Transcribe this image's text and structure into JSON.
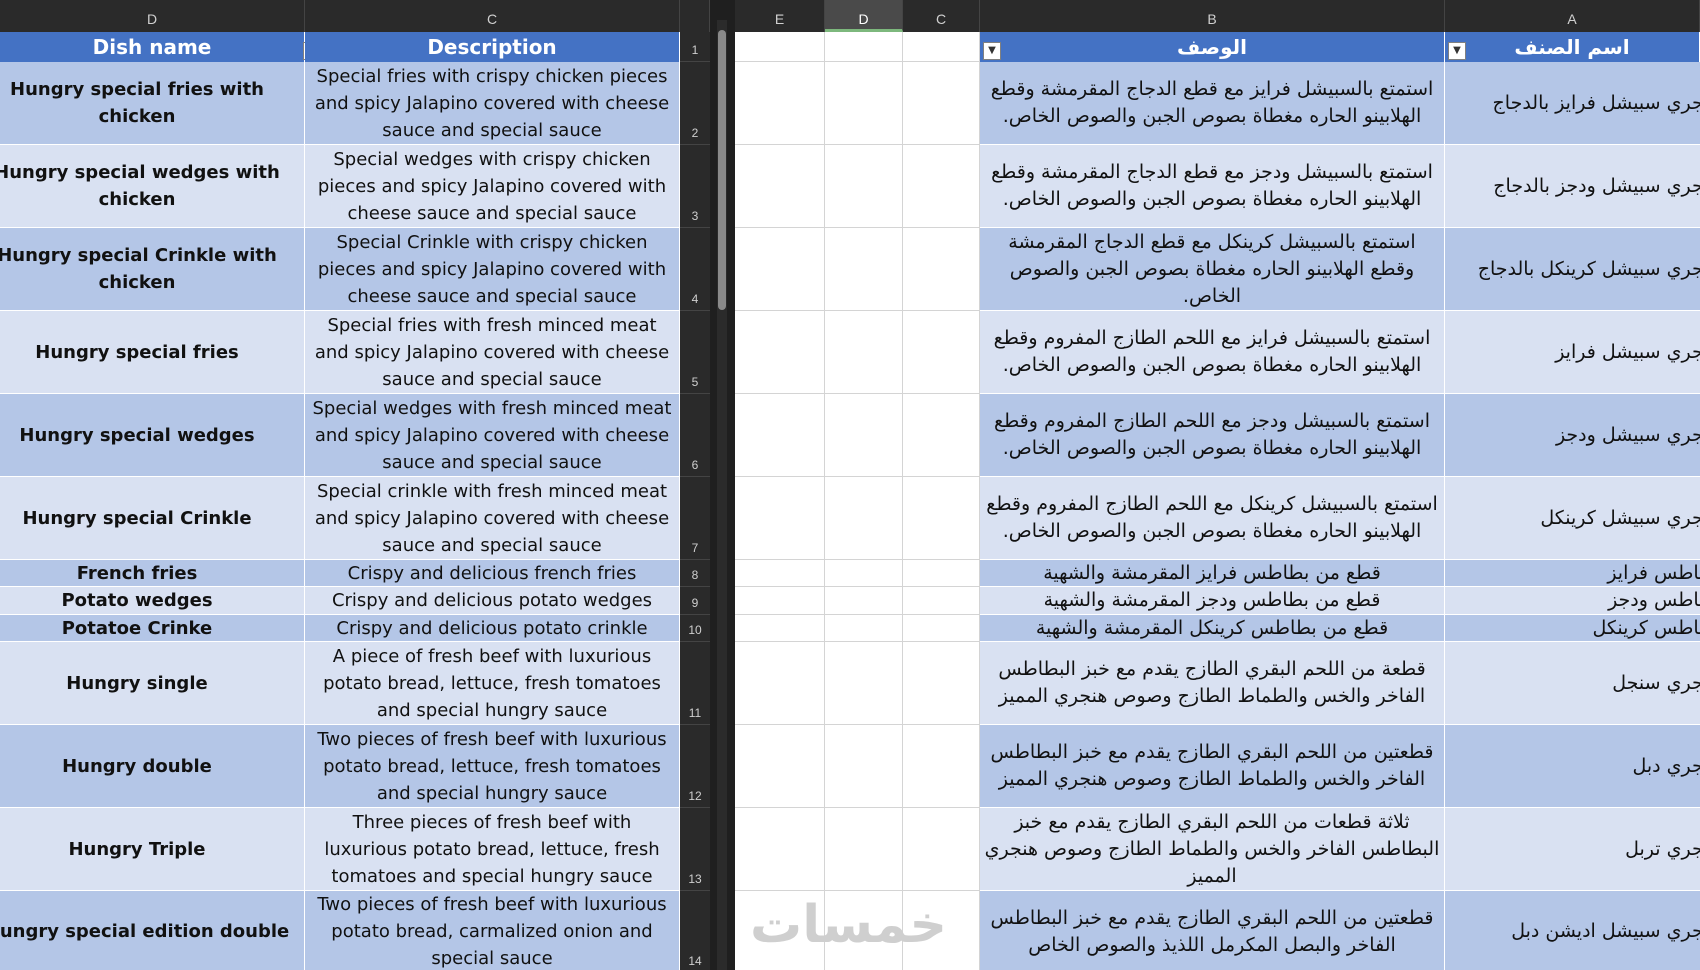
{
  "left_sheet": {
    "col_headers": [
      "D",
      "C"
    ],
    "headers": {
      "dish_name": "Dish name",
      "description": "Description"
    },
    "header_row_number": "1",
    "rows": [
      {
        "n": "2",
        "name": "Hungry special fries with chicken",
        "desc": "Special fries with crispy chicken pieces and spicy Jalapino covered with cheese sauce and special sauce"
      },
      {
        "n": "3",
        "name": "Hungry special wedges with chicken",
        "desc": "Special wedges with crispy chicken pieces and spicy Jalapino covered with cheese sauce and special sauce"
      },
      {
        "n": "4",
        "name": "Hungry special Crinkle with chicken",
        "desc": "Special Crinkle with crispy chicken pieces and spicy Jalapino covered with cheese sauce and special sauce"
      },
      {
        "n": "5",
        "name": "Hungry special fries",
        "desc": "Special fries with fresh minced meat and spicy Jalapino covered with cheese sauce and special sauce"
      },
      {
        "n": "6",
        "name": "Hungry special wedges",
        "desc": "Special wedges with fresh minced meat and spicy Jalapino covered with cheese sauce and special sauce"
      },
      {
        "n": "7",
        "name": "Hungry special Crinkle",
        "desc": "Special crinkle with fresh minced meat and spicy Jalapino covered with cheese sauce and special sauce"
      },
      {
        "n": "8",
        "name": "French fries",
        "desc": "Crispy and delicious french fries"
      },
      {
        "n": "9",
        "name": "Potato wedges",
        "desc": "Crispy and delicious potato wedges"
      },
      {
        "n": "10",
        "name": "Potatoe Crinke",
        "desc": "Crispy and delicious potato crinkle"
      },
      {
        "n": "11",
        "name": "Hungry single",
        "desc": "A piece of fresh beef with luxurious potato bread, lettuce, fresh tomatoes and special hungry sauce"
      },
      {
        "n": "12",
        "name": "Hungry double",
        "desc": "Two pieces of fresh beef with luxurious potato bread, lettuce, fresh tomatoes and special hungry sauce"
      },
      {
        "n": "13",
        "name": "Hungry Triple",
        "desc": "Three pieces of fresh beef with luxurious potato bread, lettuce, fresh tomatoes and special hungry sauce"
      },
      {
        "n": "14",
        "name": "Hungry special edition double",
        "desc": "Two pieces of fresh beef with luxurious potato bread, carmalized onion and special sauce"
      }
    ]
  },
  "right_sheet": {
    "col_headers": [
      "E",
      "D",
      "C",
      "B",
      "A"
    ],
    "selected_col": "D",
    "headers": {
      "description_ar": "الوصف",
      "dish_name_ar": "اسم الصنف"
    },
    "rows": [
      {
        "name": "هنجري سبيشل فرايز بالدجاج",
        "desc": "استمتع بالسبيشل فرايز مع قطع الدجاج المقرمشة وقطع الهلابينو الحاره مغطاة بصوص الجبن والصوص الخاص."
      },
      {
        "name": "هنجري سبيشل ودجز بالدجاج",
        "desc": "استمتع بالسبيشل ودجز مع قطع الدجاج المقرمشة وقطع الهلابينو الحاره مغطاة بصوص الجبن والصوص الخاص."
      },
      {
        "name": "هنجري سبيشل كرينكل بالدجاج",
        "desc": "استمتع بالسبيشل كرينكل مع قطع الدجاج المقرمشة وقطع الهلابينو الحاره مغطاة بصوص الجبن والصوص الخاص."
      },
      {
        "name": "هنجري سبيشل فرايز",
        "desc": "استمتع بالسبيشل فرايز مع اللحم الطازج المفروم وقطع الهلابينو الحاره مغطاة بصوص الجبن والصوص الخاص."
      },
      {
        "name": "هنجري سبيشل ودجز",
        "desc": "استمتع بالسبيشل ودجز مع اللحم الطازج المفروم وقطع الهلابينو الحاره مغطاة بصوص الجبن والصوص الخاص."
      },
      {
        "name": "هنجري سبيشل كرينكل",
        "desc": "استمتع بالسبيشل كرينكل مع اللحم الطازج المفروم وقطع الهلابينو الحاره مغطاة بصوص الجبن والصوص الخاص."
      },
      {
        "name": "بطاطس فرايز",
        "desc": "قطع من بطاطس فرايز المقرمشة والشهية"
      },
      {
        "name": "بطاطس ودجز",
        "desc": "قطع من بطاطس ودجز المقرمشة والشهية"
      },
      {
        "name": "بطاطس كرينكل",
        "desc": "قطع من بطاطس كرينكل المقرمشة والشهية"
      },
      {
        "name": "هنجري سنجل",
        "desc": "قطعة من اللحم البقري الطازج يقدم مع خبز البطاطس الفاخر والخس والطماط الطازج وصوص هنجري المميز"
      },
      {
        "name": "هنجري دبل",
        "desc": "قطعتين من اللحم البقري الطازج يقدم مع خبز البطاطس الفاخر والخس والطماط الطازج وصوص هنجري المميز"
      },
      {
        "name": "هنجري تربل",
        "desc": "ثلاثة قطعات من اللحم البقري الطازج يقدم مع خبز البطاطس الفاخر والخس والطماط الطازج وصوص هنجري المميز"
      },
      {
        "name": "هنجري سبيشل اديشن دبل",
        "desc": "قطعتين من اللحم البقري الطازج يقدم مع خبز البطاطس الفاخر والبصل المكرمل اللذيذ والصوص الخاص"
      }
    ]
  },
  "watermark": "خمسات"
}
